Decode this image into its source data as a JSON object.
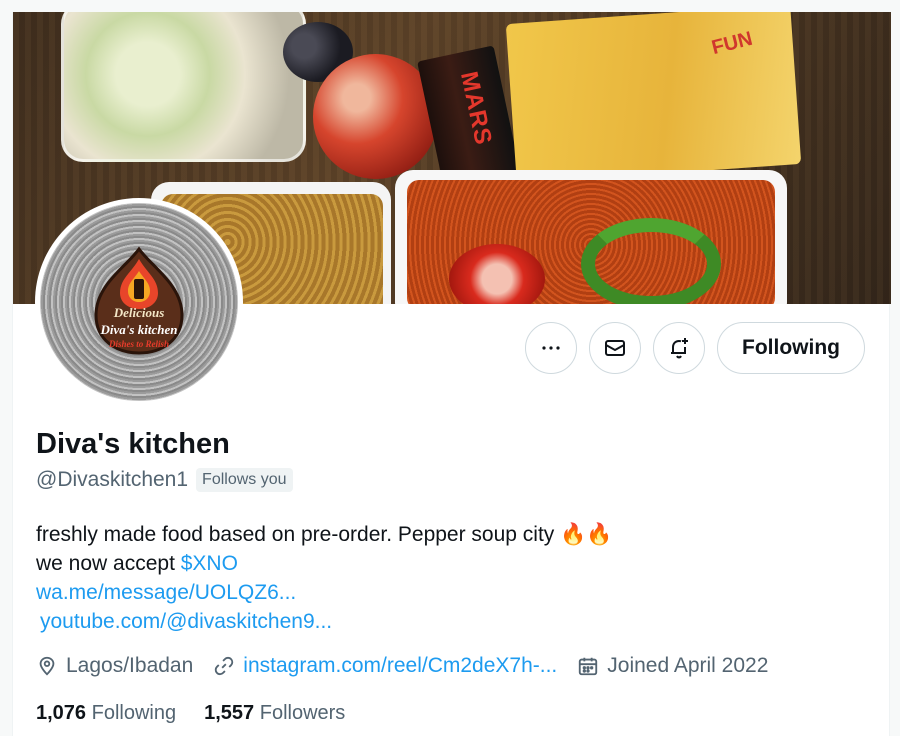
{
  "profile": {
    "name": "Diva's kitchen",
    "handle": "@Divaskitchen1",
    "follows_you_badge": "Follows you",
    "avatar": {
      "line1": "Delicious",
      "line2": "Diva's kitchen",
      "line3": "Dishes to Relish"
    },
    "banner_text": {
      "candy": "MARS",
      "cookies": "FUN"
    }
  },
  "actions": {
    "more_icon": "more-horizontal-icon",
    "message_icon": "envelope-icon",
    "notify_icon": "bell-plus-icon",
    "follow_label": "Following"
  },
  "bio": {
    "line1": "freshly made food based on pre-order. Pepper soup city 🔥🔥",
    "line2_prefix": "we now accept ",
    "line2_cashtag": "$XNO",
    "link1": "wa.me/message/UOLQZ6...",
    "link2": "youtube.com/@divaskitchen9..."
  },
  "meta": {
    "location": "Lagos/Ibadan",
    "website": "instagram.com/reel/Cm2deX7h-...",
    "joined": "Joined April 2022"
  },
  "stats": {
    "following_count": "1,076",
    "following_label": "Following",
    "followers_count": "1,557",
    "followers_label": "Followers"
  },
  "colors": {
    "accent": "#1d9bf0",
    "text": "#0f1419",
    "muted": "#536471"
  }
}
